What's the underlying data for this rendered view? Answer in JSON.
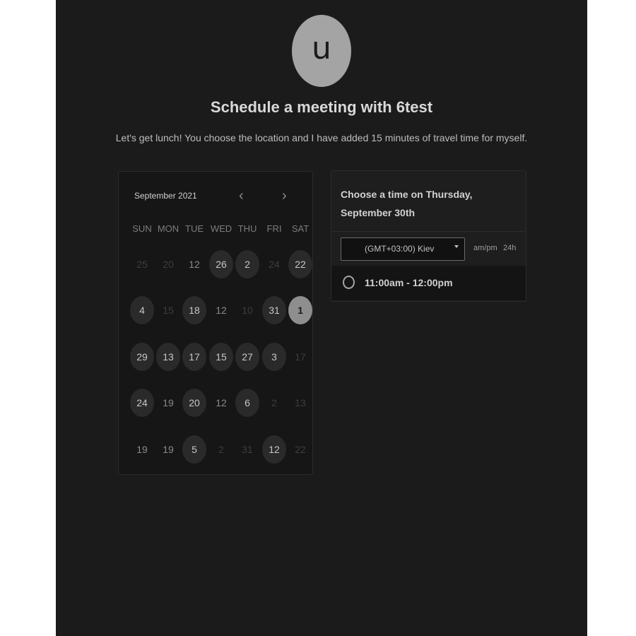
{
  "header": {
    "avatar_letter": "u",
    "title": "Schedule a meeting with 6test",
    "description": "Let's get lunch! You choose the location and I have added 15 minutes of travel time for myself."
  },
  "calendar": {
    "month_label": "September 2021",
    "prev_icon": "chevron-left-icon",
    "next_icon": "chevron-right-icon",
    "prev_glyph": "‹",
    "next_glyph": "›",
    "weekdays": [
      "SUN",
      "MON",
      "TUE",
      "WED",
      "THU",
      "FRI",
      "SAT"
    ],
    "weeks": [
      [
        {
          "day": "25",
          "state": "muted"
        },
        {
          "day": "20",
          "state": "muted"
        },
        {
          "day": "12",
          "state": "plain"
        },
        {
          "day": "26",
          "state": "available"
        },
        {
          "day": "2",
          "state": "available"
        },
        {
          "day": "24",
          "state": "muted"
        },
        {
          "day": "22",
          "state": "available"
        }
      ],
      [
        {
          "day": "4",
          "state": "available"
        },
        {
          "day": "15",
          "state": "muted"
        },
        {
          "day": "18",
          "state": "available"
        },
        {
          "day": "12",
          "state": "plain"
        },
        {
          "day": "10",
          "state": "muted"
        },
        {
          "day": "31",
          "state": "available"
        },
        {
          "day": "1",
          "state": "selected"
        }
      ],
      [
        {
          "day": "29",
          "state": "available"
        },
        {
          "day": "13",
          "state": "available"
        },
        {
          "day": "17",
          "state": "available"
        },
        {
          "day": "15",
          "state": "available"
        },
        {
          "day": "27",
          "state": "available"
        },
        {
          "day": "3",
          "state": "available"
        },
        {
          "day": "17",
          "state": "muted"
        }
      ],
      [
        {
          "day": "24",
          "state": "available"
        },
        {
          "day": "19",
          "state": "plain"
        },
        {
          "day": "20",
          "state": "available"
        },
        {
          "day": "12",
          "state": "plain"
        },
        {
          "day": "6",
          "state": "available"
        },
        {
          "day": "2",
          "state": "muted"
        },
        {
          "day": "13",
          "state": "muted"
        }
      ],
      [
        {
          "day": "19",
          "state": "plain"
        },
        {
          "day": "19",
          "state": "plain"
        },
        {
          "day": "5",
          "state": "available"
        },
        {
          "day": "2",
          "state": "muted"
        },
        {
          "day": "31",
          "state": "muted"
        },
        {
          "day": "12",
          "state": "available"
        },
        {
          "day": "22",
          "state": "muted"
        }
      ]
    ]
  },
  "times": {
    "heading": "Choose a time on Thursday, September 30th",
    "timezone": "(GMT+03:00) Kiev",
    "format_ampm": "am/pm",
    "format_24": "24h",
    "slots": [
      "11:00am - 12:00pm"
    ]
  },
  "colors": {
    "background": "#1b1b1b",
    "panel": "#161616",
    "selected_day": "#8e8e8e",
    "avatar": "#a4a4a4"
  }
}
